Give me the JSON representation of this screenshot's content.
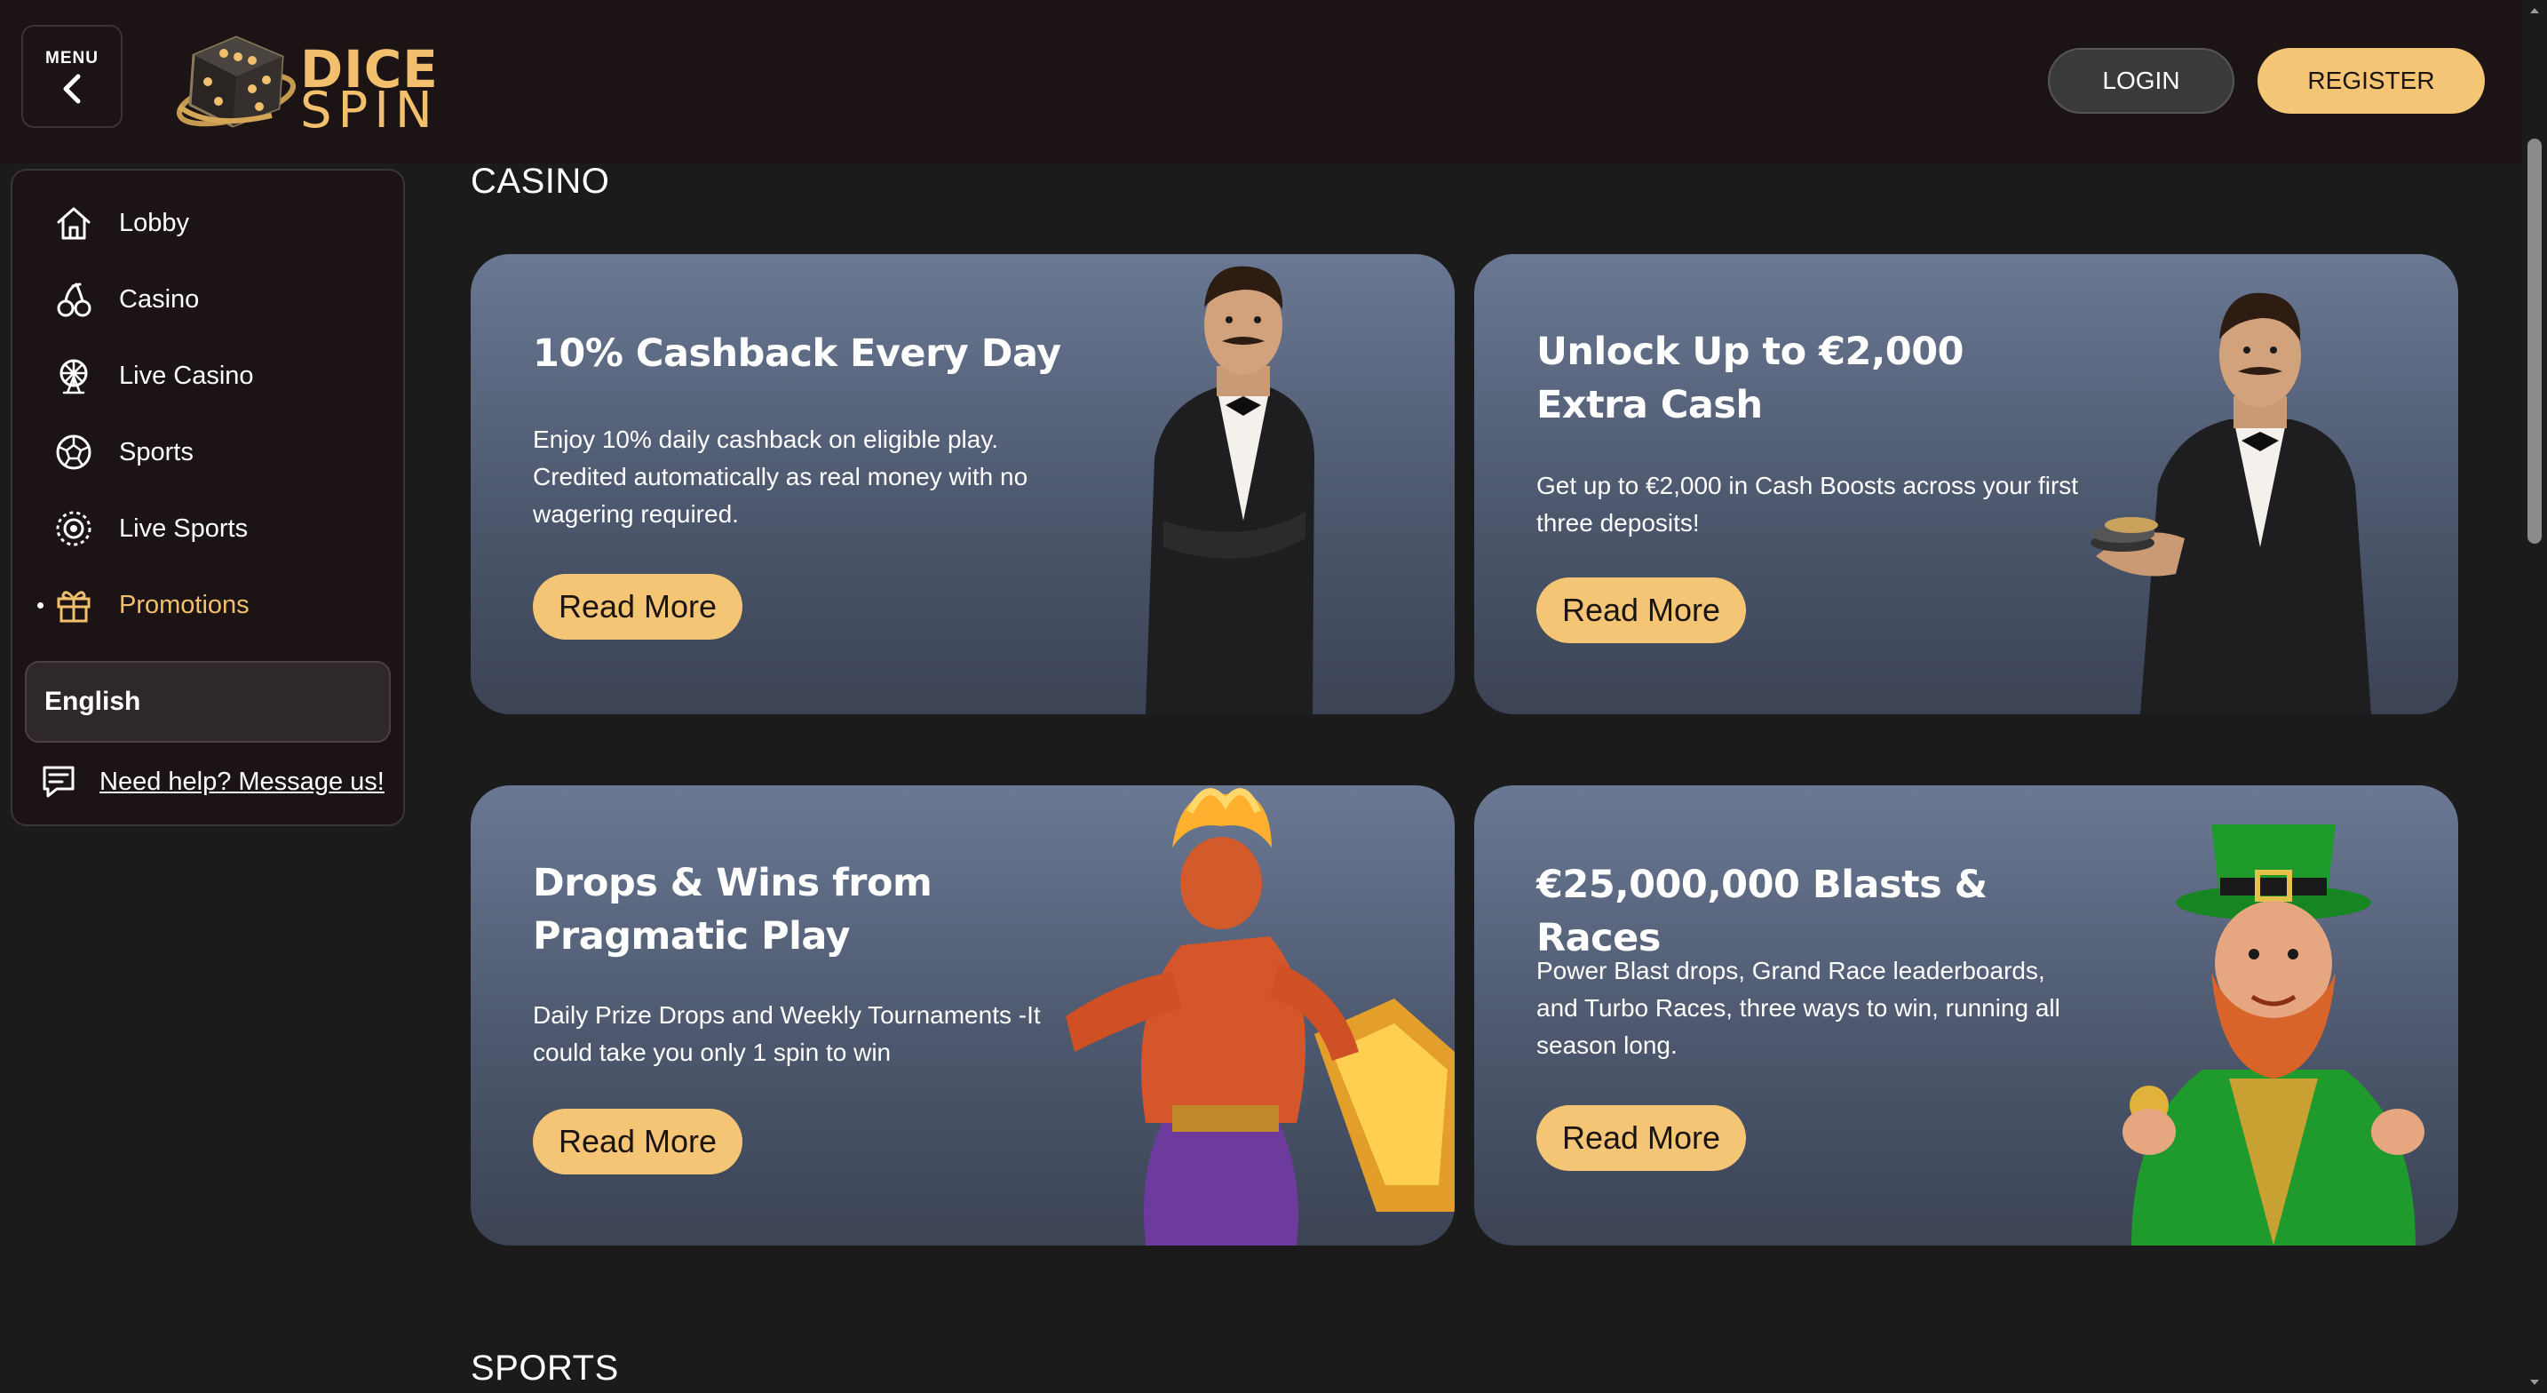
{
  "header": {
    "menu_label": "MENU",
    "logo_line1": "DICE",
    "logo_line2": "SPIN",
    "login_label": "LOGIN",
    "register_label": "REGISTER"
  },
  "sidebar": {
    "items": [
      {
        "label": "Lobby",
        "icon": "home-icon"
      },
      {
        "label": "Casino",
        "icon": "cherries-icon"
      },
      {
        "label": "Live Casino",
        "icon": "ferris-wheel-icon"
      },
      {
        "label": "Sports",
        "icon": "soccer-ball-icon"
      },
      {
        "label": "Live Sports",
        "icon": "live-target-icon"
      },
      {
        "label": "Promotions",
        "icon": "gift-icon",
        "active": true
      }
    ],
    "language": "English",
    "help_label": "Need help? Message us!"
  },
  "sections": {
    "casino_title": "CASINO",
    "sports_title": "SPORTS"
  },
  "promotions": [
    {
      "title": "10% Cashback Every Day",
      "description": "Enjoy 10% daily cashback on eligible play. Credited automatically as real money with no wagering required.",
      "button": "Read More"
    },
    {
      "title": "Unlock Up to €2,000 Extra Cash",
      "description": "Get up to €2,000 in Cash Boosts across your first three deposits!",
      "button": "Read More"
    },
    {
      "title": "Drops & Wins from Pragmatic Play",
      "description": "Daily Prize Drops and Weekly Tournaments -It could take you only 1 spin to win",
      "button": "Read More"
    },
    {
      "title": "€25,000,000 Blasts & Races",
      "description": "Power Blast drops, Grand Race leaderboards, and Turbo Races, three ways to win, running all season long.",
      "button": "Read More"
    }
  ],
  "colors": {
    "accent": "#f4c574",
    "header_bg": "#1c1414",
    "page_bg": "#1b1b1c",
    "card_top": "#6a7893",
    "card_bottom": "#3b4354"
  }
}
